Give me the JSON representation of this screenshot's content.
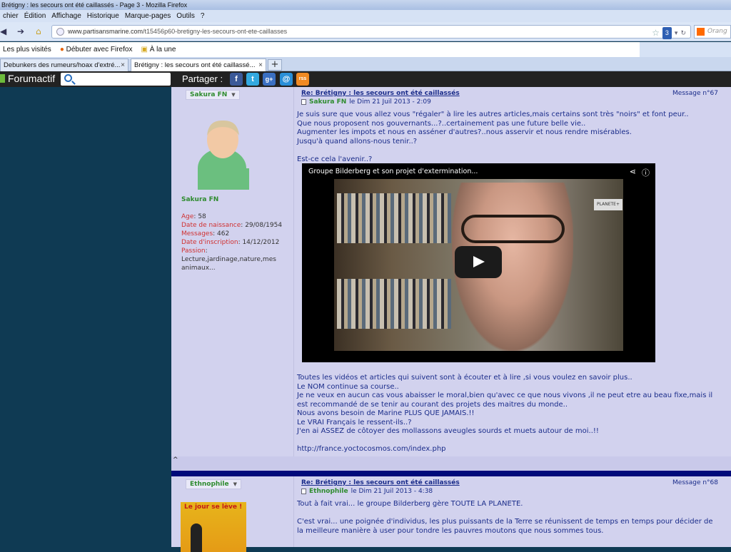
{
  "window": {
    "title": "Brétigny : les secours ont été caillassés - Page 3 - Mozilla Firefox"
  },
  "menu": [
    "chier",
    "Édition",
    "Affichage",
    "Historique",
    "Marque-pages",
    "Outils",
    "?"
  ],
  "nav": {
    "url_host": "www.partisansmarine.com",
    "url_path": "/t15456p60-bretigny-les-secours-ont-ete-caillasses",
    "badge": "3",
    "search_placeholder": "Orang"
  },
  "bookmarks": [
    "Les plus visités",
    "Débuter avec Firefox",
    "À la une"
  ],
  "tabs": [
    {
      "label": "Debunkers des rumeurs/hoax d'extré..."
    },
    {
      "label": "Brétigny : les secours ont été caillassé..."
    }
  ],
  "forumbar": {
    "logo": "Forumactif",
    "share": "Partager :",
    "social": [
      "f",
      "t",
      "g+",
      "@",
      "rss"
    ]
  },
  "post1": {
    "author": "Sakura FN",
    "title": "Re: Brétigny : les secours ont été caillassés",
    "msg": "Message n°67",
    "date_name": "Sakura FN",
    "date": "le Dim 21 Juil 2013 - 2:09",
    "profile_name": "Sakura FN",
    "age_k": "Age",
    "age_v": ": 58",
    "birth_k": "Date de naissance",
    "birth_v": ": 29/08/1954",
    "msgs_k": "Messages",
    "msgs_v": ": 462",
    "ins_k": "Date d'inscription",
    "ins_v": ": 14/12/2012",
    "pass_k": "Passion",
    "pass_v": ":\nLecture,jardinage,nature,mes animaux...",
    "body1": "Je suis sure que vous allez vous \"régaler\" à lire les autres articles,mais certains sont très \"noirs\" et font peur..\nQue nous proposent nos gouvernants...?..certainement pas une future belle vie..\nAugmenter les impots et nous en asséner d'autres?..nous asservir et nous rendre misérables.\nJusqu'à quand allons-nous tenir..?\n\nEst-ce cela l'avenir..?",
    "video_title": "Groupe Bilderberg et son projet d'extermination...",
    "video_logo": "PLANETE+",
    "body2": "Toutes les vidéos et articles  qui suivent sont à écouter et à lire ,si vous voulez en savoir plus..\nLe NOM continue sa course..\nJe ne veux en aucun cas vous abaisser le moral,bien qu'avec ce que nous vivons ,il ne peut etre au beau fixe,mais il est recommandé de se tenir au courant des projets des maitres du monde..\nNous avons besoin de Marine PLUS QUE JAMAIS.!!\nLe VRAI Français le ressent-ils..?\nJ'en ai ASSEZ de côtoyer des mollassons aveugles sourds et muets autour de moi..!!",
    "link": "http://france.yoctocosmos.com/index.php",
    "footer": "^"
  },
  "post2": {
    "author": "Ethnophile",
    "title": "Re: Brétigny : les secours ont été caillassés",
    "msg": "Message n°68",
    "date_name": "Ethnophile",
    "date": "le Dim 21 Juil 2013 - 4:38",
    "avatar_text": "Le jour se lève !",
    "body": "Tout à fait vrai... le groupe Bilderberg gère TOUTE LA PLANETE.\n\nC'est vrai... une poignée d'individus, les plus puissants de la Terre se réunissent de temps en temps pour décider de la meilleure manière à user pour tondre les pauvres moutons que nous sommes tous."
  },
  "colors": {
    "link": "#1a2c8a",
    "name": "#2e8b2e",
    "key": "#d03030",
    "post_bg": "#d2d2ee",
    "sidebar": "#0f3a53"
  }
}
